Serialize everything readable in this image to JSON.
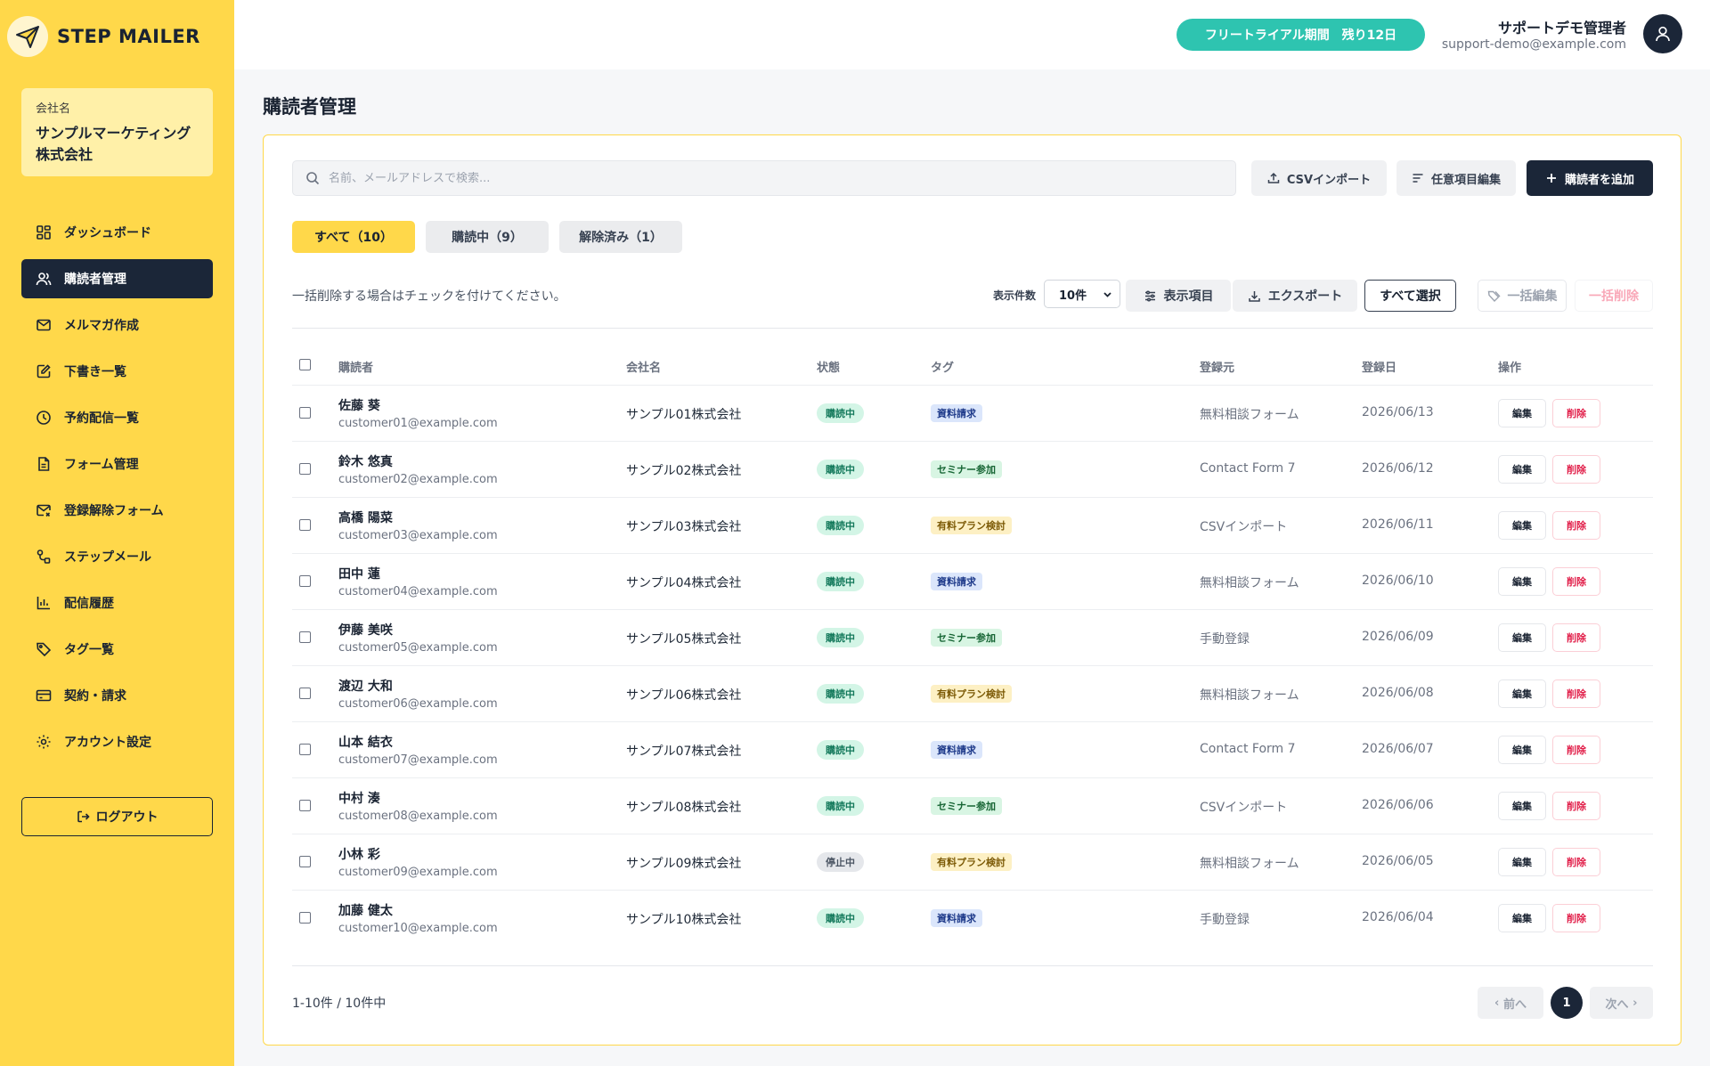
{
  "app": {
    "logo_text": "STEP MAILER"
  },
  "company": {
    "label": "会社名",
    "name_line1": "サンプルマーケティング",
    "name_line2": "株式会社"
  },
  "sidebar": {
    "items": [
      {
        "label": "ダッシュボード",
        "icon": "grid-icon"
      },
      {
        "label": "購読者管理",
        "icon": "users-icon",
        "active": true
      },
      {
        "label": "メルマガ作成",
        "icon": "mail-icon"
      },
      {
        "label": "下書き一覧",
        "icon": "edit-icon"
      },
      {
        "label": "予約配信一覧",
        "icon": "clock-icon"
      },
      {
        "label": "フォーム管理",
        "icon": "document-icon"
      },
      {
        "label": "登録解除フォーム",
        "icon": "mail-x-icon"
      },
      {
        "label": "ステップメール",
        "icon": "route-icon"
      },
      {
        "label": "配信履歴",
        "icon": "bar-chart-icon"
      },
      {
        "label": "タグ一覧",
        "icon": "tag-icon"
      },
      {
        "label": "契約・請求",
        "icon": "credit-card-icon"
      },
      {
        "label": "アカウント設定",
        "icon": "gear-icon"
      }
    ],
    "logout_label": "ログアウト"
  },
  "header": {
    "trial_label": "フリートライアル期間　残り12日",
    "user_name": "サポートデモ管理者",
    "user_email": "support-demo@example.com"
  },
  "page": {
    "title": "購読者管理"
  },
  "search": {
    "placeholder": "名前、メールアドレスで検索..."
  },
  "toolbar": {
    "csv_import": "CSVインポート",
    "custom_fields": "任意項目編集",
    "add_subscriber": "購読者を追加"
  },
  "tabs": [
    {
      "label": "すべて（10）",
      "active": true
    },
    {
      "label": "購読中（9）"
    },
    {
      "label": "解除済み（1）"
    }
  ],
  "list_controls": {
    "hint": "一括削除する場合はチェックを付けてください。",
    "per_page_label": "表示件数",
    "per_page_value": "10件",
    "columns_btn": "表示項目",
    "export_btn": "エクスポート",
    "select_all_btn": "すべて選択",
    "bulk_edit_btn": "一括編集",
    "bulk_delete_btn": "一括削除"
  },
  "table": {
    "headers": {
      "subscriber": "購読者",
      "company": "会社名",
      "status": "状態",
      "tags": "タグ",
      "source": "登録元",
      "date": "登録日",
      "actions": "操作"
    },
    "edit_label": "編集",
    "delete_label": "削除",
    "rows": [
      {
        "name": "佐藤 葵",
        "email": "customer01@example.com",
        "company": "サンプル01株式会社",
        "status": "購読中",
        "tag": "資料請求",
        "source": "無料相談フォーム",
        "date": "2026/06/13"
      },
      {
        "name": "鈴木 悠真",
        "email": "customer02@example.com",
        "company": "サンプル02株式会社",
        "status": "購読中",
        "tag": "セミナー参加",
        "source": "Contact Form 7",
        "date": "2026/06/12"
      },
      {
        "name": "高橋 陽菜",
        "email": "customer03@example.com",
        "company": "サンプル03株式会社",
        "status": "購読中",
        "tag": "有料プラン検討",
        "source": "CSVインポート",
        "date": "2026/06/11"
      },
      {
        "name": "田中 蓮",
        "email": "customer04@example.com",
        "company": "サンプル04株式会社",
        "status": "購読中",
        "tag": "資料請求",
        "source": "無料相談フォーム",
        "date": "2026/06/10"
      },
      {
        "name": "伊藤 美咲",
        "email": "customer05@example.com",
        "company": "サンプル05株式会社",
        "status": "購読中",
        "tag": "セミナー参加",
        "source": "手動登録",
        "date": "2026/06/09"
      },
      {
        "name": "渡辺 大和",
        "email": "customer06@example.com",
        "company": "サンプル06株式会社",
        "status": "購読中",
        "tag": "有料プラン検討",
        "source": "無料相談フォーム",
        "date": "2026/06/08"
      },
      {
        "name": "山本 結衣",
        "email": "customer07@example.com",
        "company": "サンプル07株式会社",
        "status": "購読中",
        "tag": "資料請求",
        "source": "Contact Form 7",
        "date": "2026/06/07"
      },
      {
        "name": "中村 湊",
        "email": "customer08@example.com",
        "company": "サンプル08株式会社",
        "status": "購読中",
        "tag": "セミナー参加",
        "source": "CSVインポート",
        "date": "2026/06/06"
      },
      {
        "name": "小林 彩",
        "email": "customer09@example.com",
        "company": "サンプル09株式会社",
        "status": "停止中",
        "tag": "有料プラン検討",
        "source": "無料相談フォーム",
        "date": "2026/06/05"
      },
      {
        "name": "加藤 健太",
        "email": "customer10@example.com",
        "company": "サンプル10株式会社",
        "status": "購読中",
        "tag": "資料請求",
        "source": "手動登録",
        "date": "2026/06/04"
      }
    ]
  },
  "pagination": {
    "summary": "1-10件 / 10件中",
    "prev": "前へ",
    "current": "1",
    "next": "次へ"
  },
  "colors": {
    "sidebar_bg": "#ffd84a",
    "accent_dark": "#1b2638",
    "trial_bg": "#2ec4b0",
    "danger": "#e11d48"
  }
}
